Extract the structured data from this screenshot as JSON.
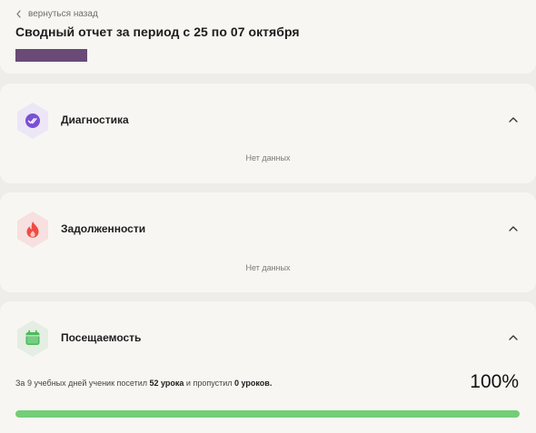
{
  "header": {
    "back_label": "вернуться назад",
    "title": "Сводный отчет за период с 25 по 07 октября"
  },
  "sections": {
    "diagnostics": {
      "title": "Диагностика",
      "empty": "Нет данных",
      "icon": "double-check-icon",
      "accent": "#7b4fd6",
      "hex_bg": "#ece6f6"
    },
    "debts": {
      "title": "Задолженности",
      "empty": "Нет данных",
      "icon": "flame-icon",
      "accent": "#ef4b44",
      "hex_bg": "#f7e0df"
    },
    "attendance": {
      "title": "Посещаемость",
      "icon": "calendar-icon",
      "accent": "#4cbb5a",
      "hex_bg": "#e4eee2",
      "text_prefix": "За 9 учебных дней ученик посетил ",
      "attended": "52 урока",
      "text_middle": " и пропустил ",
      "missed": "0 уроков.",
      "percent": "100%",
      "progress": 1.0,
      "progress_color": "#72cf76"
    }
  }
}
